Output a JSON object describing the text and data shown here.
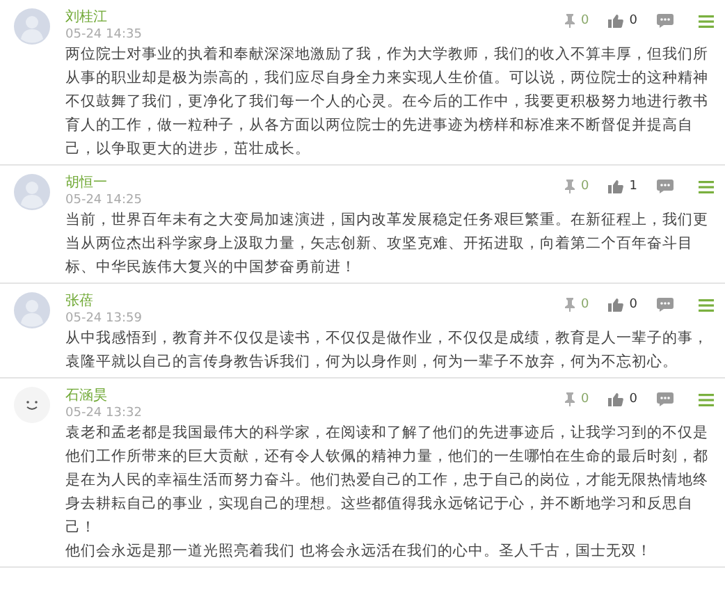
{
  "comments": [
    {
      "avatar": {
        "kind": "default"
      },
      "author": "刘桂江",
      "time": "05-24 14:35",
      "pin_count": "0",
      "like_count": "0",
      "paragraphs": [
        "两位院士对事业的执着和奉献深深地激励了我，作为大学教师，我们的收入不算丰厚，但我们所从事的职业却是极为崇高的，我们应尽自身全力来实现人生价值。可以说，两位院士的这种精神不仅鼓舞了我们，更净化了我们每一个人的心灵。在今后的工作中，我要更积极努力地进行教书育人的工作，做一粒种子，从各方面以两位院士的先进事迹为榜样和标准来不断督促并提高自己，以争取更大的进步，茁壮成长。"
      ]
    },
    {
      "avatar": {
        "kind": "default"
      },
      "author": "胡恒一",
      "time": "05-24 14:25",
      "pin_count": "0",
      "like_count": "1",
      "paragraphs": [
        "当前，世界百年未有之大变局加速演进，国内改革发展稳定任务艰巨繁重。在新征程上，我们更当从两位杰出科学家身上汲取力量，矢志创新、攻坚克难、开拓进取，向着第二个百年奋斗目标、中华民族伟大复兴的中国梦奋勇前进！"
      ]
    },
    {
      "avatar": {
        "kind": "default"
      },
      "author": "张蓓",
      "time": "05-24 13:59",
      "pin_count": "0",
      "like_count": "0",
      "paragraphs": [
        "从中我感悟到，教育并不仅仅是读书，不仅仅是做作业，不仅仅是成绩，教育是人一辈子的事，袁隆平就以自己的言传身教告诉我们，何为以身作则，何为一辈子不放弃，何为不忘初心。"
      ]
    },
    {
      "avatar": {
        "kind": "smiley"
      },
      "author": "石涵昊",
      "time": "05-24 13:32",
      "pin_count": "0",
      "like_count": "0",
      "paragraphs": [
        "袁老和孟老都是我国最伟大的科学家，在阅读和了解了他们的先进事迹后，让我学习到的不仅是他们工作所带来的巨大贡献，还有令人钦佩的精神力量，他们的一生哪怕在生命的最后时刻，都是在为人民的幸福生活而努力奋斗。他们热爱自己的工作，忠于自己的岗位，才能无限热情地终身去耕耘自己的事业，实现自己的理想。这些都值得我永远铭记于心，并不断地学习和反思自己！",
        "他们会永远是那一道光照亮着我们 也将会永远活在我们的心中。圣人千古，国士无双！"
      ]
    }
  ]
}
